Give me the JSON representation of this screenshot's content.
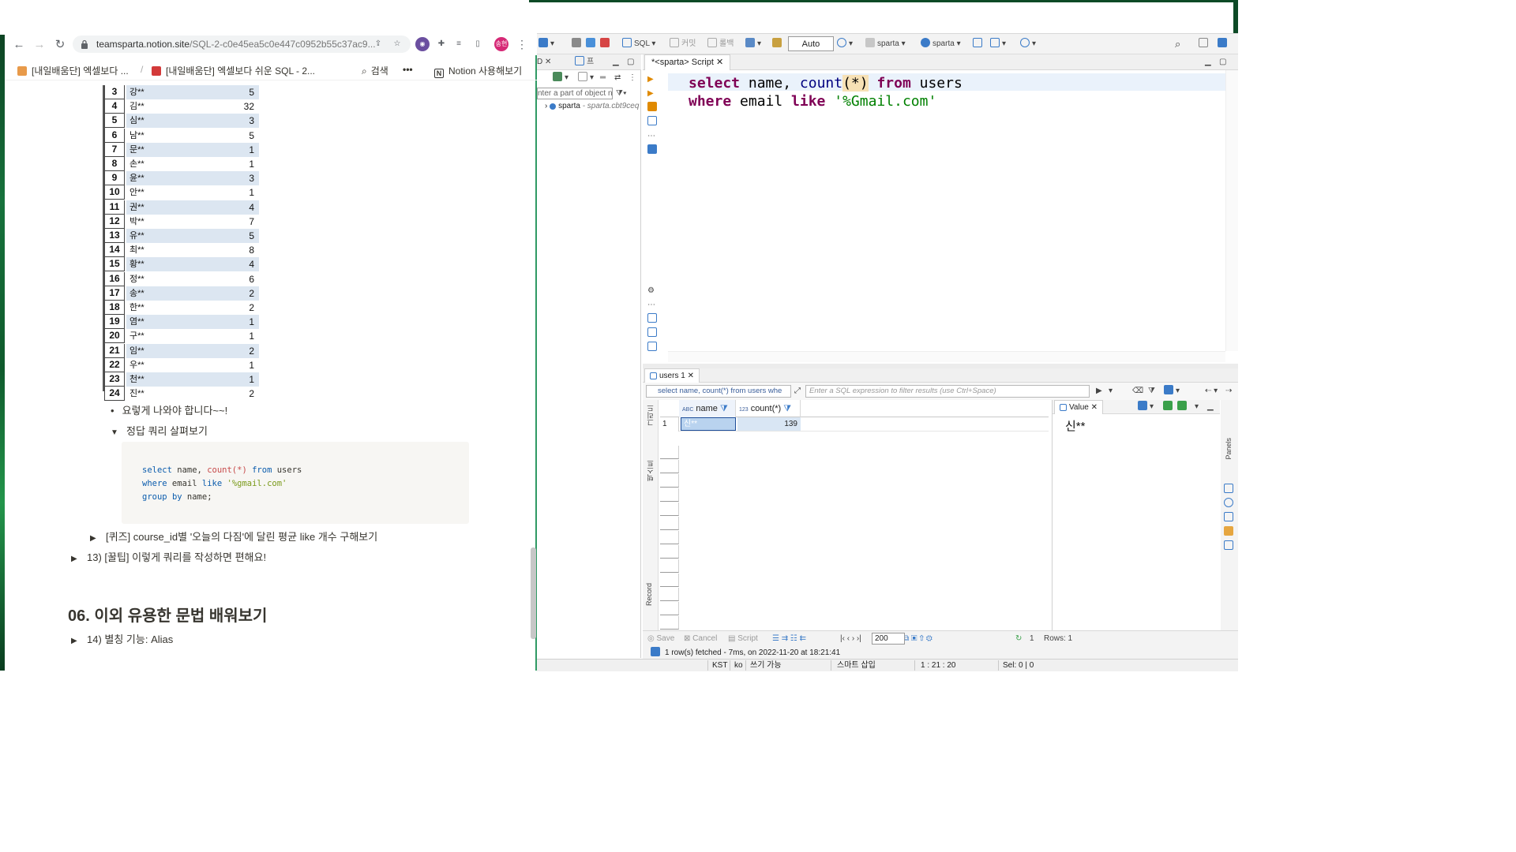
{
  "browser": {
    "url_host": "teamsparta.notion.site",
    "url_path": "/SQL-2-c0e45ea5c0e447c0952b55c37ac9...",
    "profile_label": "송현",
    "breadcrumb_1": "[내일배움단] 엑셀보다 ...",
    "breadcrumb_sep": "/",
    "breadcrumb_2": "[내일배움단] 엑셀보다 쉬운 SQL - 2...",
    "search_label": "검색",
    "more_label": "•••",
    "notion_cta": "Notion 사용해보기"
  },
  "notion": {
    "table_rows": [
      {
        "idx": "3",
        "name": "강**",
        "value": "5"
      },
      {
        "idx": "4",
        "name": "김**",
        "value": "32"
      },
      {
        "idx": "5",
        "name": "심**",
        "value": "3"
      },
      {
        "idx": "6",
        "name": "남**",
        "value": "5"
      },
      {
        "idx": "7",
        "name": "문**",
        "value": "1"
      },
      {
        "idx": "8",
        "name": "손**",
        "value": "1"
      },
      {
        "idx": "9",
        "name": "윤**",
        "value": "3"
      },
      {
        "idx": "10",
        "name": "안**",
        "value": "1"
      },
      {
        "idx": "11",
        "name": "권**",
        "value": "4"
      },
      {
        "idx": "12",
        "name": "박**",
        "value": "7"
      },
      {
        "idx": "13",
        "name": "유**",
        "value": "5"
      },
      {
        "idx": "14",
        "name": "최**",
        "value": "8"
      },
      {
        "idx": "15",
        "name": "황**",
        "value": "4"
      },
      {
        "idx": "16",
        "name": "정**",
        "value": "6"
      },
      {
        "idx": "17",
        "name": "송**",
        "value": "2"
      },
      {
        "idx": "18",
        "name": "한**",
        "value": "2"
      },
      {
        "idx": "19",
        "name": "염**",
        "value": "1"
      },
      {
        "idx": "20",
        "name": "구**",
        "value": "1"
      },
      {
        "idx": "21",
        "name": "임**",
        "value": "2"
      },
      {
        "idx": "22",
        "name": "우**",
        "value": "1"
      },
      {
        "idx": "23",
        "name": "천**",
        "value": "1"
      },
      {
        "idx": "24",
        "name": "진**",
        "value": "2"
      }
    ],
    "bullet_text": "요렇게 나와야 합니다~~!",
    "toggle_answer": "정답 쿼리 살펴보기",
    "code_line_1": {
      "kw1": "select",
      "mid": " name, ",
      "fn": "count(*)",
      "sp": " ",
      "kw2": "from",
      "tail": " users"
    },
    "code_line_2": {
      "kw1": "where",
      "mid": " email ",
      "kw2": "like",
      "sp": " ",
      "str": "'%gmail.com'"
    },
    "code_line_3": {
      "kw1": "group",
      "sp": " ",
      "kw2": "by",
      "tail": " name;"
    },
    "toggle_quiz": "[퀴즈] course_id별 '오늘의 다짐'에 달린 평균 like 개수 구해보기",
    "toggle_tip": "13) [꿀팁] 이렇게 쿼리를 작성하면 편해요!",
    "section_heading": "06. 이외 유용한 문법 배워보기",
    "toggle_alias": "14) 별칭 기능: Alias"
  },
  "dbeaver": {
    "toolbar": {
      "sql_label": "SQL",
      "commit_label": "커밋",
      "rollback_label": "롤백",
      "auto_label": "Auto",
      "datasource_label": "sparta",
      "schema_label": "sparta"
    },
    "nav": {
      "tab_label": "D",
      "tab2_label": "프",
      "filter_placeholder": "nter a part of object n",
      "tree_item": "sparta",
      "tree_host": "- sparta.cbt9ceq"
    },
    "editor": {
      "tab_label": "*<sparta> Script",
      "line1": {
        "kw1": "select",
        "mid": " name, ",
        "fn": "count",
        "paren": "(*)",
        "sp": " ",
        "kw2": "from",
        "tail": " users"
      },
      "line2": {
        "kw1": "where",
        "mid": " email ",
        "kw2": "like",
        "sp": " ",
        "str": "'%Gmail.com'"
      }
    },
    "results": {
      "tab_label": "users 1",
      "filter_query": "select name, count(*) from users whe",
      "filter_placeholder": "Enter a SQL expression to filter results (use Ctrl+Space)",
      "side_grid_label": "그리드",
      "side_text_label": "텍스트",
      "side_record_label": "Record",
      "col_name_type": "ABC",
      "col_name": "name",
      "col_count_type": "123",
      "col_count": "count(*)",
      "row_num": "1",
      "cell_name": "신**",
      "cell_count": "139",
      "value_tab": "Value",
      "value_text": "신**",
      "panels_label": "Panels"
    },
    "results_toolbar": {
      "save": "Save",
      "cancel": "Cancel",
      "script": "Script",
      "fetch_size": "200",
      "count": "1",
      "rows": "Rows: 1"
    },
    "fetch_status": "1 row(s) fetched - 7ms, on 2022-11-20 at 18:21:41",
    "statusbar": {
      "tz": "KST",
      "lang": "ko",
      "mode": "쓰기 가능",
      "insert": "스마트 삽입",
      "pos": "1 : 21 : 20",
      "sel": "Sel: 0 | 0"
    }
  }
}
